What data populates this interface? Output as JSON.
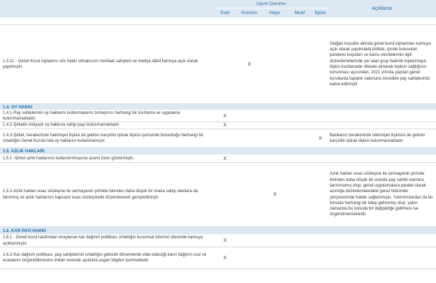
{
  "header": {
    "title": "Uyum Durumu",
    "description": "Açıklama",
    "columns": [
      "Evet",
      "Kısmen",
      "Hayır",
      "Muaf",
      "İlgisiz"
    ]
  },
  "rows": [
    {
      "text": "1.3.11 - Genel Kurul toplantısı söz hakkı olmaksızın menfaat sahipleri ve medya dâhil kamuya açık olarak yapılmıştır.",
      "mark": "X",
      "desc": "Olağan koşullar altında genel kurul toplantıları kamuya açık olarak yapılmakla birlikte, içinde bulunulan pandemi koşulları ve kamu otoritelerinin ilgili düzenlemelerinde yer alan grup halinde toplanmaya ilişkin kısıtlamalar dikkate alınarak toplum sağlığının korunması açısından, 2021 yılında yapılan genel kurullarda toplantı salonuna öncelikle pay sahiplerimiz kabul edilmiştir"
    },
    {
      "section": "1.4. OY HAKKI"
    },
    {
      "text": "1.4.1-Pay sahiplerinin oy haklarını kullanmalarını zorlaştırıcı herhangi bir kısıtlama ve uygulama bulunmamaktadır.",
      "mark": "X",
      "desc": ""
    },
    {
      "text": "1.4.2-Şirketin imtiyazlı oy hakkına sahip payı bulunmamaktadır.",
      "mark": "X",
      "desc": ""
    },
    {
      "text": "1.4.3-Şirket, beraberinde hakimiyet ilişkisi de getiren karşılıklı iştirak ilişkisi içerisinde bulunduğu herhangi bir ortaklığın Genel Kurulu'nda oy haklarını kullanmamıştır.",
      "mark": "X",
      "desc": "Bankanın beraberinde hâkimiyet ilişkisini de getiren karşılıklı iştirak ilişkisi bulunmamaktadır."
    },
    {
      "section": "1.5. AZLIK HAKLARI"
    },
    {
      "text": "1.5.1 -Şirket azlık haklarının kullandırılmasına azami özen göstermiştir.",
      "mark": "X",
      "desc": ""
    },
    {
      "text": "1.5.2-Azlık hakları esas sözleşme ile sermayenin yirmide birinden daha düşük bir orana sahip olanlara da tanınmış ve azlık haklarının kapsamı esas sözleşmede düzenlenerek genişletilmiştir.",
      "mark": "X",
      "desc": "Azlık hakları esas sözleşme ile sermayenin yirmide birinden daha düşük bir oranda pay sahibi olanlara tanınmamış olup, genel uygulamalara paralel olarak azınlığa düzenlemelerdeki genel hükümler çerçevesinde haklar sağlanmıştır. Yatırımcılardan da bu konuda herhangi bir talep gelmemiş olup, yakın zamanda bu konuda bir değişikliğe gidilmesi ise öngörülmemektedir."
    },
    {
      "section": "1.6. KAR PAYI HAKKI"
    },
    {
      "text": "1.6.1 - Genel kurul tarafından onaylanan kar dağıtım politikası ortaklığın kurumsal internet sitesinde kamuya açıklanmıştır.",
      "mark": "X",
      "desc": ""
    },
    {
      "text": "1.6.2-Kar dağıtım politikası, pay sahiplerinin ortaklığın gelecek dönemlerde elde edeceği karın dağıtım usul ve esaslarını öngörebilmesine imkân verecek açıklıkta asgari bilgileri içermektedir.",
      "mark": "X",
      "desc": ""
    }
  ]
}
